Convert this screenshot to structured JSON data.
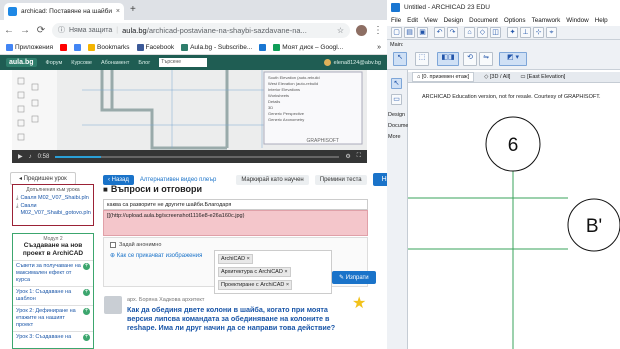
{
  "chrome": {
    "tab_title": "archicad: Поставяне на шайби",
    "tab_close": "×",
    "newtab": "+",
    "nav": {
      "back": "←",
      "forward": "→",
      "reload": "⟳"
    },
    "secure_label": "Няма защита",
    "url_domain": "aula.bg",
    "url_path": "/archicad-postaviane-na-shaybi-sazdavane-na...",
    "bookmarks": [
      {
        "label": "Приложения",
        "color": "#4285f4"
      },
      {
        "label": "",
        "color": "#ff0000"
      },
      {
        "label": "",
        "color": "#4285f4"
      },
      {
        "label": "Bookmarks",
        "color": "#f4b400"
      },
      {
        "label": "Facebook",
        "color": "#3b5998"
      },
      {
        "label": "Aula.bg - Subscribe...",
        "color": "#2e7d6b"
      },
      {
        "label": "",
        "color": "#1976d2"
      },
      {
        "label": "Моят диск – Googl...",
        "color": "#0f9d58"
      }
    ],
    "more_bookmarks": "»"
  },
  "site": {
    "logo": "aula.bg",
    "nav": [
      "Форум",
      "Курсове",
      "Абонамент",
      "Блог"
    ],
    "search_placeholder": "Търсене",
    "user": "elena8124@abv.bg",
    "video_time": "0:58",
    "video_brand": "GRAPHISOFT",
    "subnav": {
      "back": "‹ Назад",
      "alt_player": "Алтернативен видео плеър",
      "mark_done": "Маркирай като научен",
      "test": "Премини теста",
      "next": "Напред ›"
    },
    "prev_lesson": "◂ Предишен урок",
    "files_heading": "Допълнения към урока",
    "files": [
      "Сваля M02_V07_Shaibi.pln",
      "Свали M02_V07_Shaibi_gotovo.pln"
    ],
    "module": {
      "label": "Модул 2",
      "title": "Създаване на нов проект в ArchiCAD",
      "items": [
        "Съвети за получаване на максимален ефект от курса",
        "Урок 1: Създаване на шаблон",
        "Урок 2: Дефиниране на етажите на нашият проект",
        "Урок 3: Създаване на"
      ]
    },
    "qa": {
      "title": "Въпроси и отговори",
      "question_input": "каква са разворите не другите шайби.Благодаря",
      "question_body": "[[(http://upload.aula.bg/screenshot1116e8-e26a160c.jpg)",
      "anon_label": "Задай анонимно",
      "howto_link": "Как се прикачват изображения",
      "tags": [
        "ArchiCAD",
        "Архитектура с ArchiCAD",
        "Проектиране с ArchiCAD"
      ],
      "submit": "Изпрати"
    },
    "answer": {
      "meta": "арх. Борянa Хадкова архитект",
      "title": "Как да обединя двете колони в шайба, когато при моята версия липсва командата за обединяване на колоните в reshape. Има ли друг начин да се направи това действие?"
    }
  },
  "acad": {
    "window_title": "Untitled - ARCHICAD 23 EDU",
    "menu": [
      "File",
      "Edit",
      "View",
      "Design",
      "Document",
      "Options",
      "Teamwork",
      "Window",
      "Help"
    ],
    "main_label": "Main:",
    "tabs": [
      "[0. приземен етаж]",
      "[3D / All]",
      "[East Elevation]"
    ],
    "side": [
      "Design",
      "Documen",
      "More"
    ],
    "watermark": "ARCHICAD Education version, not for resale. Courtesy of GRAPHISOFT.",
    "markers": [
      "6",
      "B'"
    ]
  }
}
